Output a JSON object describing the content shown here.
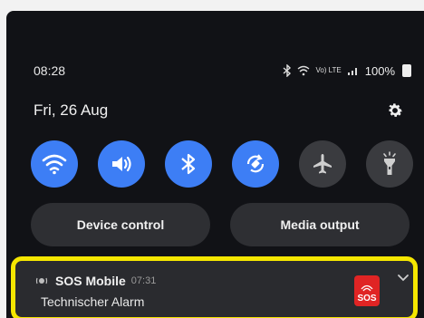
{
  "status_bar": {
    "time": "08:28",
    "signal_text": "Vo) LTE",
    "battery": "100%"
  },
  "header": {
    "date": "Fri, 26 Aug"
  },
  "quick_toggles": [
    {
      "name": "wifi",
      "icon": "wifi-icon",
      "state": "on"
    },
    {
      "name": "sound",
      "icon": "volume-icon",
      "state": "on"
    },
    {
      "name": "bluetooth",
      "icon": "bluetooth-icon",
      "state": "on"
    },
    {
      "name": "auto-rotate",
      "icon": "rotate-icon",
      "state": "on"
    },
    {
      "name": "airplane-mode",
      "icon": "airplane-icon",
      "state": "off"
    },
    {
      "name": "flashlight",
      "icon": "flashlight-icon",
      "state": "off"
    }
  ],
  "pills": {
    "device_control": "Device control",
    "media_output": "Media output"
  },
  "notification": {
    "app_name": "SOS Mobile",
    "time": "07:31",
    "text": "Technischer Alarm",
    "badge_text": "SOS",
    "highlight_color": "#f5e600"
  },
  "colors": {
    "accent": "#3d7ef5",
    "panel": "#111216",
    "sos_red": "#e02424"
  }
}
